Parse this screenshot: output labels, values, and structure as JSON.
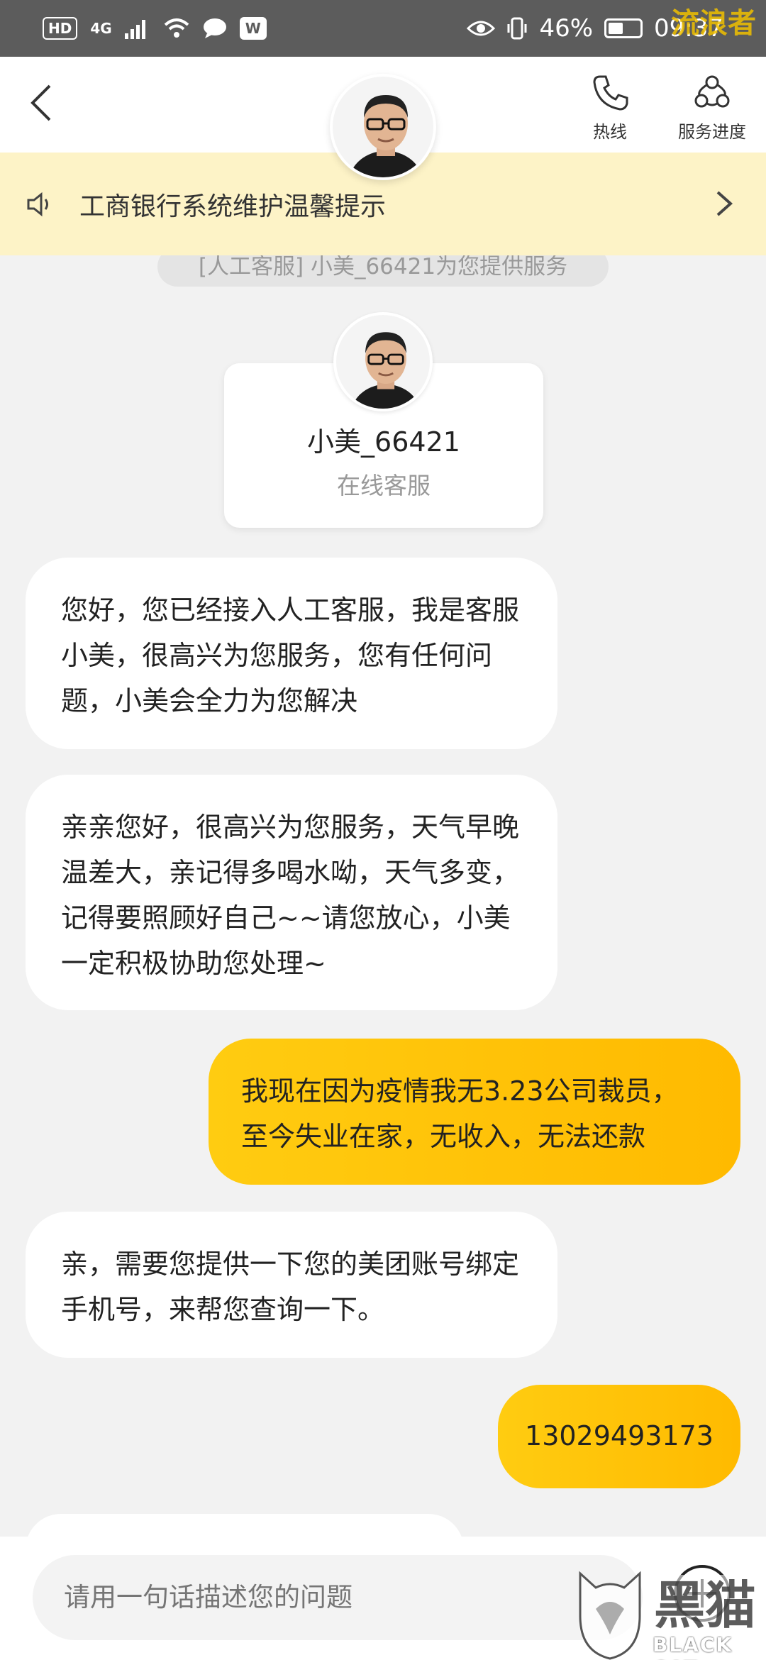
{
  "status_bar": {
    "hd_badge": "HD",
    "network": "4G",
    "app_badge": "W",
    "battery": "46%",
    "time": "09:37",
    "watermark": "流浪者"
  },
  "header": {
    "hotline_label": "热线",
    "progress_label": "服务进度"
  },
  "notice": {
    "text": "工商银行系统维护温馨提示"
  },
  "system_tag": "[人工客服] 小美_66421为您提供服务",
  "agent": {
    "name": "小美_66421",
    "role": "在线客服"
  },
  "messages": [
    {
      "side": "left",
      "text": "您好，您已经接入人工客服，我是客服小美，很高兴为您服务，您有任何问题，小美会全力为您解决"
    },
    {
      "side": "left",
      "text": "亲亲您好，很高兴为您服务，天气早晚温差大，亲记得多喝水呦，天气多变，记得要照顾好自己~~请您放心，小美一定积极协助您处理~"
    },
    {
      "side": "right",
      "text": "我现在因为疫情我无3.23公司裁员，至今失业在家，无收入，无法还款"
    },
    {
      "side": "left",
      "text": "亲，需要您提供一下您的美团账号绑定手机号，来帮您查询一下。"
    },
    {
      "side": "right",
      "text": "13029493173"
    }
  ],
  "input": {
    "placeholder": "请用一句话描述您的问题"
  },
  "watermark_bottom": {
    "text": "BLACK CAT",
    "brand_cn": "黑猫"
  },
  "colors": {
    "accent": "#ffc107",
    "notice_bg": "#fdf3c7",
    "status_bar_bg": "#5c5c5c"
  }
}
